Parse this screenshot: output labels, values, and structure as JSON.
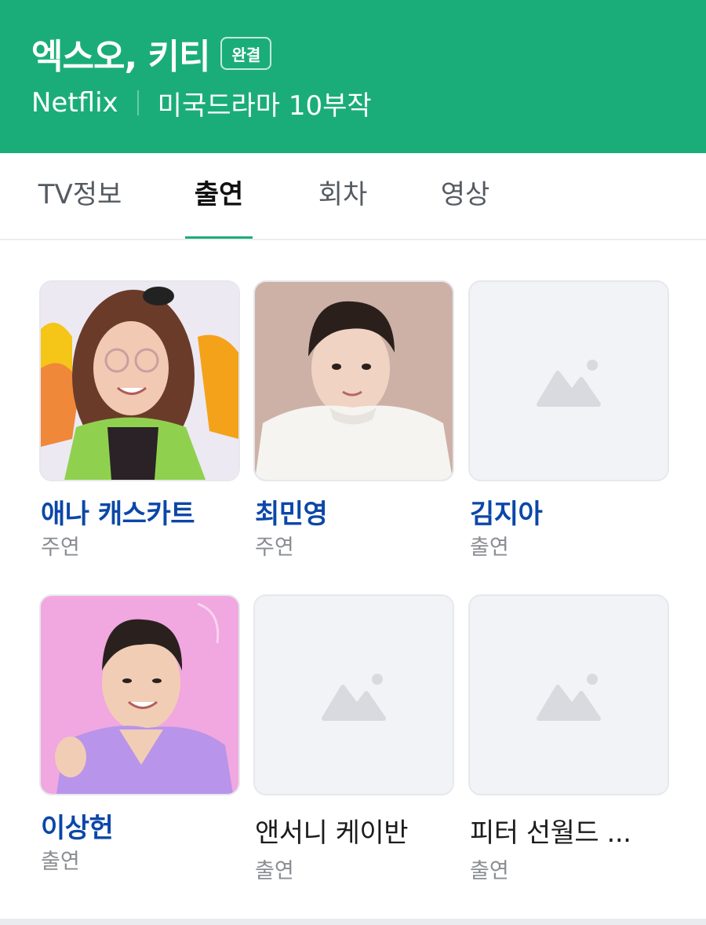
{
  "header": {
    "title": "엑스오, 키티",
    "badge": "완결",
    "network": "Netflix",
    "info": "미국드라마 10부작",
    "accent_color": "#1bad79"
  },
  "tabs": [
    {
      "label": "TV정보",
      "active": false
    },
    {
      "label": "출연",
      "active": true
    },
    {
      "label": "회차",
      "active": false
    },
    {
      "label": "영상",
      "active": false
    }
  ],
  "cast": [
    {
      "name": "애나 캐스카트",
      "role": "주연",
      "linked": true,
      "photo": "woman-with-glasses-photo"
    },
    {
      "name": "최민영",
      "role": "주연",
      "linked": true,
      "photo": "man-white-sweater-photo"
    },
    {
      "name": "김지아",
      "role": "출연",
      "linked": true,
      "photo": "image-placeholder-icon"
    },
    {
      "name": "이상헌",
      "role": "출연",
      "linked": true,
      "photo": "man-purple-suit-photo"
    },
    {
      "name": "앤서니 케이반",
      "role": "출연",
      "linked": false,
      "photo": "image-placeholder-icon"
    },
    {
      "name": "피터 선월드 ...",
      "role": "출연",
      "linked": false,
      "photo": "image-placeholder-icon"
    }
  ]
}
